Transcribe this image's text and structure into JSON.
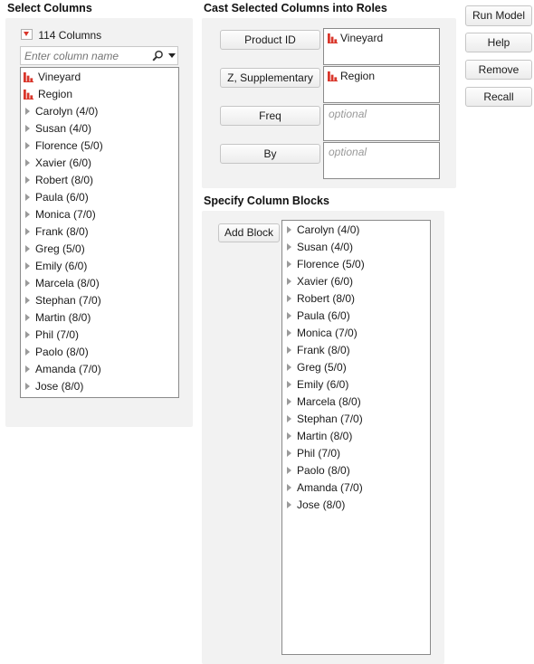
{
  "select_columns": {
    "title": "Select Columns",
    "count_label": "114 Columns",
    "search_placeholder": "Enter column name",
    "items": [
      {
        "label": "Vineyard",
        "type": "nominal"
      },
      {
        "label": "Region",
        "type": "nominal"
      },
      {
        "label": "Carolyn (4/0)",
        "type": "group"
      },
      {
        "label": "Susan (4/0)",
        "type": "group"
      },
      {
        "label": "Florence (5/0)",
        "type": "group"
      },
      {
        "label": "Xavier (6/0)",
        "type": "group"
      },
      {
        "label": "Robert (8/0)",
        "type": "group"
      },
      {
        "label": "Paula (6/0)",
        "type": "group"
      },
      {
        "label": "Monica (7/0)",
        "type": "group"
      },
      {
        "label": "Frank (8/0)",
        "type": "group"
      },
      {
        "label": "Greg (5/0)",
        "type": "group"
      },
      {
        "label": "Emily (6/0)",
        "type": "group"
      },
      {
        "label": "Marcela (8/0)",
        "type": "group"
      },
      {
        "label": "Stephan (7/0)",
        "type": "group"
      },
      {
        "label": "Martin (8/0)",
        "type": "group"
      },
      {
        "label": "Phil (7/0)",
        "type": "group"
      },
      {
        "label": "Paolo (8/0)",
        "type": "group"
      },
      {
        "label": "Amanda (7/0)",
        "type": "group"
      },
      {
        "label": "Jose (8/0)",
        "type": "group"
      }
    ]
  },
  "roles": {
    "title": "Cast Selected Columns into Roles",
    "items": [
      {
        "button": "Product ID",
        "value": "Vineyard",
        "placeholder": ""
      },
      {
        "button": "Z, Supplementary",
        "value": "Region",
        "placeholder": ""
      },
      {
        "button": "Freq",
        "value": "",
        "placeholder": "optional"
      },
      {
        "button": "By",
        "value": "",
        "placeholder": "optional"
      }
    ]
  },
  "actions": {
    "run": "Run Model",
    "help": "Help",
    "remove": "Remove",
    "recall": "Recall"
  },
  "blocks": {
    "title": "Specify Column Blocks",
    "add_label": "Add Block",
    "items": [
      "Carolyn (4/0)",
      "Susan (4/0)",
      "Florence (5/0)",
      "Xavier (6/0)",
      "Robert (8/0)",
      "Paula (6/0)",
      "Monica (7/0)",
      "Frank (8/0)",
      "Greg (5/0)",
      "Emily (6/0)",
      "Marcela (8/0)",
      "Stephan (7/0)",
      "Martin (8/0)",
      "Phil (7/0)",
      "Paolo (8/0)",
      "Amanda (7/0)",
      "Jose (8/0)"
    ]
  },
  "colors": {
    "nominal_icon": "#d9362b",
    "disclosure_icon": "#d9362b",
    "panel_bg": "#f2f2f2"
  }
}
